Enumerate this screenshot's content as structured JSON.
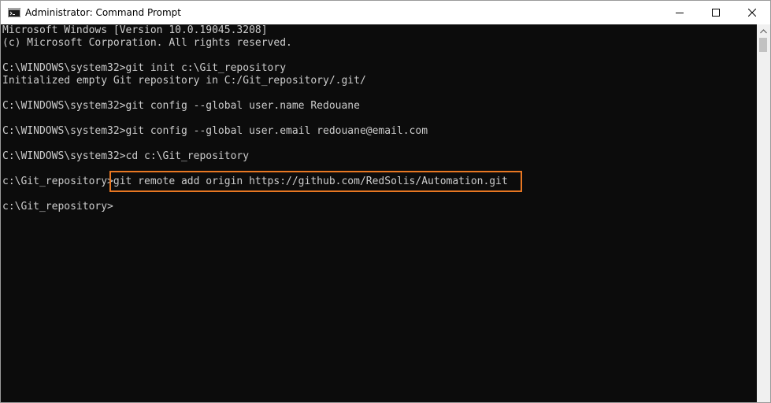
{
  "window": {
    "title": "Administrator: Command Prompt",
    "icon": "cmd-icon",
    "controls": {
      "minimize": "minimize-icon",
      "maximize": "maximize-icon",
      "close": "close-icon"
    }
  },
  "console": {
    "lines": [
      "Microsoft Windows [Version 10.0.19045.3208]",
      "(c) Microsoft Corporation. All rights reserved.",
      "",
      "C:\\WINDOWS\\system32>git init c:\\Git_repository",
      "Initialized empty Git repository in C:/Git_repository/.git/",
      "",
      "C:\\WINDOWS\\system32>git config --global user.name Redouane",
      "",
      "C:\\WINDOWS\\system32>git config --global user.email redouane@email.com",
      "",
      "C:\\WINDOWS\\system32>cd c:\\Git_repository",
      "",
      "c:\\Git_repository>git remote add origin https://github.com/RedSolis/Automation.git",
      "",
      "c:\\Git_repository>"
    ]
  },
  "colors": {
    "background": "#0c0c0c",
    "text": "#cccccc",
    "highlight": "#e87722",
    "titlebar": "#ffffff"
  }
}
